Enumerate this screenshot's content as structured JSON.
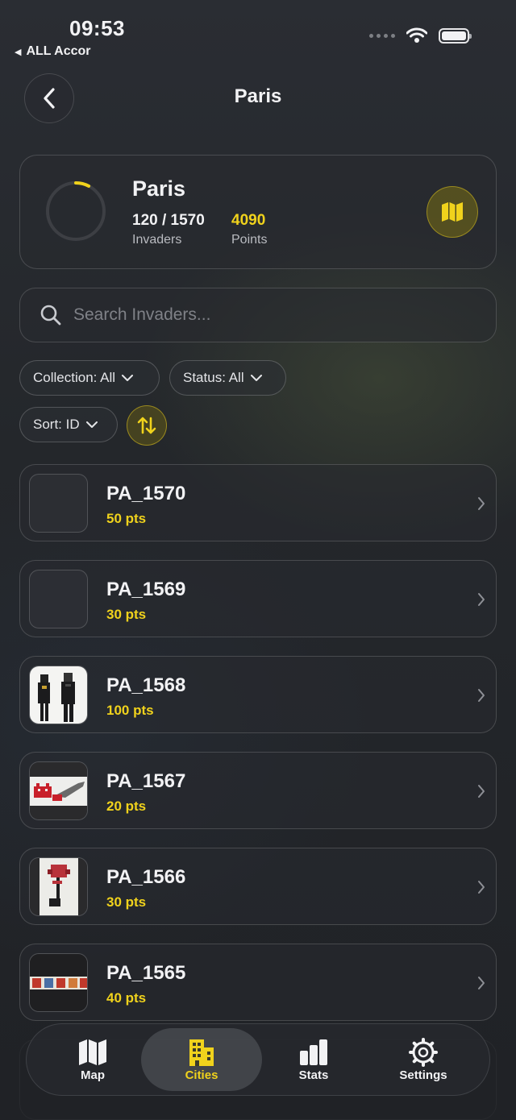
{
  "status_bar": {
    "time": "09:53",
    "back_app": "ALL Accor"
  },
  "header": {
    "title": "Paris"
  },
  "summary": {
    "city": "Paris",
    "found": "120 / 1570",
    "found_label": "Invaders",
    "points": "4090",
    "points_label": "Points",
    "progress_fraction": 0.076
  },
  "search": {
    "placeholder": "Search Invaders..."
  },
  "filters": {
    "collection": "Collection: All",
    "status": "Status: All",
    "sort": "Sort: ID"
  },
  "invaders": [
    {
      "id": "PA_1570",
      "points": "50 pts",
      "thumb": "empty"
    },
    {
      "id": "PA_1569",
      "points": "30 pts",
      "thumb": "empty"
    },
    {
      "id": "PA_1568",
      "points": "100 pts",
      "thumb": "two-figures"
    },
    {
      "id": "PA_1567",
      "points": "20 pts",
      "thumb": "red-invader-hand"
    },
    {
      "id": "PA_1566",
      "points": "30 pts",
      "thumb": "red-figure"
    },
    {
      "id": "PA_1565",
      "points": "40 pts",
      "thumb": "ghost-row"
    }
  ],
  "tabs": [
    {
      "label": "Map",
      "icon": "map-icon"
    },
    {
      "label": "Cities",
      "icon": "building-icon",
      "active": true
    },
    {
      "label": "Stats",
      "icon": "bar-chart-icon"
    },
    {
      "label": "Settings",
      "icon": "gear-icon"
    }
  ],
  "colors": {
    "accent": "#f0d21c",
    "background": "#24272b"
  }
}
